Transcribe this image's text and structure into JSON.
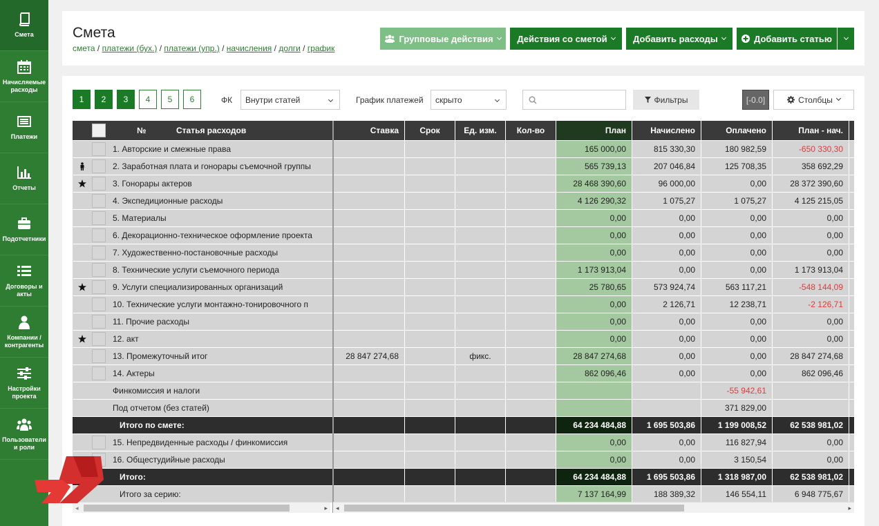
{
  "sidebar": {
    "items": [
      {
        "label": "Смета",
        "icon": "book-icon"
      },
      {
        "label": "Начисляемые расходы",
        "icon": "calendar-icon"
      },
      {
        "label": "Платежи",
        "icon": "list-window-icon"
      },
      {
        "label": "Отчеты",
        "icon": "bar-chart-icon"
      },
      {
        "label": "Подотчетники",
        "icon": "briefcase-icon"
      },
      {
        "label": "Договоры и акты",
        "icon": "list-icon"
      },
      {
        "label": "Компании / контрагенты",
        "icon": "user-icon"
      },
      {
        "label": "Настройки проекта",
        "icon": "sliders-icon"
      },
      {
        "label": "Пользователи и роли",
        "icon": "users-icon"
      }
    ]
  },
  "header": {
    "title": "Смета",
    "breadcrumbs": [
      "смета",
      "платежи (бух.)",
      "платежи (упр.)",
      "начисления",
      "долги",
      "график"
    ],
    "group_actions": "Групповые действия",
    "estimate_actions": "Действия со сметой",
    "add_expenses": "Добавить расходы",
    "add_article": "Добавить статью"
  },
  "toolbar": {
    "pages": [
      "1",
      "2",
      "3",
      "4",
      "5",
      "6"
    ],
    "fk_label": "ФК",
    "fk_value": "Внутри статей",
    "schedule_label": "График платежей",
    "schedule_value": "скрыто",
    "search_placeholder": "",
    "filters": "Фильтры",
    "counter": "[-0.0]",
    "columns": "Столбцы"
  },
  "table": {
    "headers": {
      "num": "№",
      "article": "Статья расходов",
      "rate": "Ставка",
      "term": "Срок",
      "unit": "Ед. изм.",
      "qty": "Кол-во",
      "plan": "План",
      "accrued": "Начислено",
      "paid": "Оплачено",
      "plan_minus_acc": "План - нач."
    },
    "rows": [
      {
        "marker": "",
        "name": "1. Авторские и смежные права",
        "rate": "",
        "unit": "",
        "plan": "165 000,00",
        "accrued": "815 330,30",
        "paid": "180 982,59",
        "diff": "-650 330,30",
        "diff_neg": true,
        "checkbox": true
      },
      {
        "marker": "person",
        "name": "2. Заработная плата и гонорары съемочной группы",
        "rate": "",
        "unit": "",
        "plan": "565 739,13",
        "accrued": "207 046,84",
        "paid": "125 708,35",
        "diff": "358 692,29",
        "checkbox": true
      },
      {
        "marker": "star",
        "name": "3. Гонорары актеров",
        "rate": "",
        "unit": "",
        "plan": "28 468 390,60",
        "accrued": "96 000,00",
        "paid": "0,00",
        "diff": "28 372 390,60",
        "checkbox": true
      },
      {
        "marker": "",
        "name": "4. Экспедиционные расходы",
        "rate": "",
        "unit": "",
        "plan": "4 126 290,32",
        "accrued": "1 075,27",
        "paid": "1 075,27",
        "diff": "4 125 215,05",
        "checkbox": true
      },
      {
        "marker": "",
        "name": "5. Материалы",
        "rate": "",
        "unit": "",
        "plan": "0,00",
        "accrued": "0,00",
        "paid": "0,00",
        "diff": "0,00",
        "checkbox": true
      },
      {
        "marker": "",
        "name": "6. Декорационно-техническое оформление проекта",
        "rate": "",
        "unit": "",
        "plan": "0,00",
        "accrued": "0,00",
        "paid": "0,00",
        "diff": "0,00",
        "checkbox": true
      },
      {
        "marker": "",
        "name": "7. Художественно-постановочные расходы",
        "rate": "",
        "unit": "",
        "plan": "0,00",
        "accrued": "0,00",
        "paid": "0,00",
        "diff": "0,00",
        "checkbox": true
      },
      {
        "marker": "",
        "name": "8. Технические услуги съемочного периода",
        "rate": "",
        "unit": "",
        "plan": "1 173 913,04",
        "accrued": "0,00",
        "paid": "0,00",
        "diff": "1 173 913,04",
        "checkbox": true
      },
      {
        "marker": "star",
        "name": "9. Услуги специализированных организаций",
        "rate": "",
        "unit": "",
        "plan": "25 780,65",
        "accrued": "573 924,74",
        "paid": "563 117,21",
        "diff": "-548 144,09",
        "diff_neg": true,
        "checkbox": true
      },
      {
        "marker": "",
        "name": "10. Технические услуги монтажно-тонировочного п",
        "rate": "",
        "unit": "",
        "plan": "0,00",
        "accrued": "2 126,71",
        "paid": "12 238,71",
        "diff": "-2 126,71",
        "diff_neg": true,
        "checkbox": true
      },
      {
        "marker": "",
        "name": "11. Прочие расходы",
        "rate": "",
        "unit": "",
        "plan": "0,00",
        "accrued": "0,00",
        "paid": "0,00",
        "diff": "0,00",
        "checkbox": true
      },
      {
        "marker": "star",
        "name": "12. акт",
        "rate": "",
        "unit": "",
        "plan": "0,00",
        "accrued": "0,00",
        "paid": "0,00",
        "diff": "0,00",
        "checkbox": true
      },
      {
        "marker": "",
        "name": "13. Промежуточный итог",
        "rate": "28 847 274,68",
        "unit": "фикс.",
        "plan": "28 847 274,68",
        "accrued": "0,00",
        "paid": "0,00",
        "diff": "28 847 274,68",
        "checkbox": true
      },
      {
        "marker": "",
        "name": "14. Актеры",
        "rate": "",
        "unit": "",
        "plan": "862 096,46",
        "accrued": "0,00",
        "paid": "0,00",
        "diff": "862 096,46",
        "checkbox": true
      },
      {
        "marker": "",
        "name": "Финкомиссия и налоги",
        "rate": "",
        "unit": "",
        "plan": "",
        "accrued": "",
        "paid": "-55 942,61",
        "paid_neg": true,
        "diff": "",
        "checkbox": false
      },
      {
        "marker": "",
        "name": "Под отчетом (без статей)",
        "rate": "",
        "unit": "",
        "plan": "",
        "accrued": "",
        "paid": "371 829,00",
        "diff": "",
        "checkbox": false
      },
      {
        "marker": "",
        "name": "Итого по смете:",
        "total": true,
        "rate": "",
        "unit": "",
        "plan": "64 234 484,88",
        "accrued": "1 695 503,86",
        "paid": "1 199 008,52",
        "diff": "62 538 981,02",
        "checkbox": false
      },
      {
        "marker": "",
        "name": "15. Непредвиденные расходы / финкомиссия",
        "rate": "",
        "unit": "",
        "plan": "0,00",
        "accrued": "0,00",
        "paid": "116 827,94",
        "diff": "0,00",
        "checkbox": true
      },
      {
        "marker": "",
        "name": "16. Общестудийные расходы",
        "rate": "",
        "unit": "",
        "plan": "0,00",
        "accrued": "0,00",
        "paid": "3 150,54",
        "diff": "0,00",
        "checkbox": true
      },
      {
        "marker": "",
        "name": "Итого:",
        "total": true,
        "rate": "",
        "unit": "",
        "plan": "64 234 484,88",
        "accrued": "1 695 503,86",
        "paid": "1 318 987,00",
        "diff": "62 538 981,02",
        "checkbox": false
      },
      {
        "marker": "",
        "name": "Итого за серию:",
        "series": true,
        "rate": "",
        "unit": "",
        "plan": "7 137 164,99",
        "accrued": "188 389,32",
        "paid": "146 554,11",
        "diff": "6 948 775,67",
        "checkbox": false
      }
    ]
  },
  "colors": {
    "brand": "#2e7d32",
    "brand_dark": "#1b7a26",
    "group_btn": "#7dbf85",
    "plan_col": "#a4c9a0",
    "row_bg": "#d4d4d4",
    "total_bg": "#2d2d2d",
    "negative": "#e53935"
  }
}
